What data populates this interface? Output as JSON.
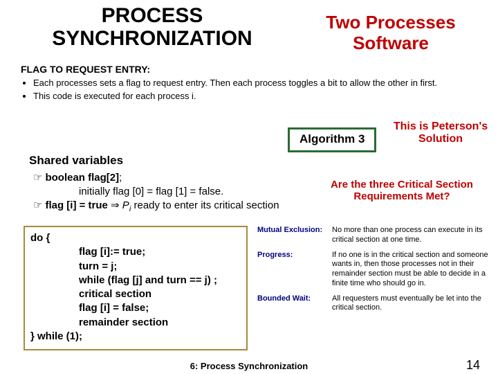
{
  "title_left": "PROCESS SYNCHRONIZATION",
  "title_right": "Two Processes Software",
  "section_heading": "FLAG TO REQUEST ENTRY:",
  "bullets": [
    "Each processes sets a flag to request entry. Then each process toggles a bit to allow the other in first.",
    "This code is executed for each process i."
  ],
  "alg_badge": "Algorithm 3",
  "peterson": "This is Peterson's Solution",
  "shared_vars": "Shared variables",
  "hand1_bold": "boolean flag[2]",
  "hand1_tail": ";",
  "init": "initially flag [0] = flag [1] = false.",
  "hand2_bold": "flag [i] = true",
  "hand2_tail_a": " ⇒ ",
  "hand2_tail_b": "P",
  "hand2_tail_c": " ready to enter its critical section",
  "req_q": "Are the three Critical Section Requirements Met?",
  "code": {
    "l0": "do {",
    "l1": "flag [i]:= true;",
    "l2": "turn = j;",
    "l3": "while (flag [j] and turn == j) ;",
    "l4": "critical section",
    "l5": "flag [i] = false;",
    "l6": "remainder section",
    "l7": "} while (1);"
  },
  "reqs": [
    {
      "label": "Mutual Exclusion:",
      "text": "No more than one process can execute in its critical section at one time."
    },
    {
      "label": "Progress:",
      "text": "If no one is in the critical section and someone wants in, then those processes not in their remainder section must be able to decide in a finite time who should go in."
    },
    {
      "label": "Bounded Wait:",
      "text": "All requesters must eventually be let into the critical section."
    }
  ],
  "footer": "6: Process Synchronization",
  "page_num": "14"
}
